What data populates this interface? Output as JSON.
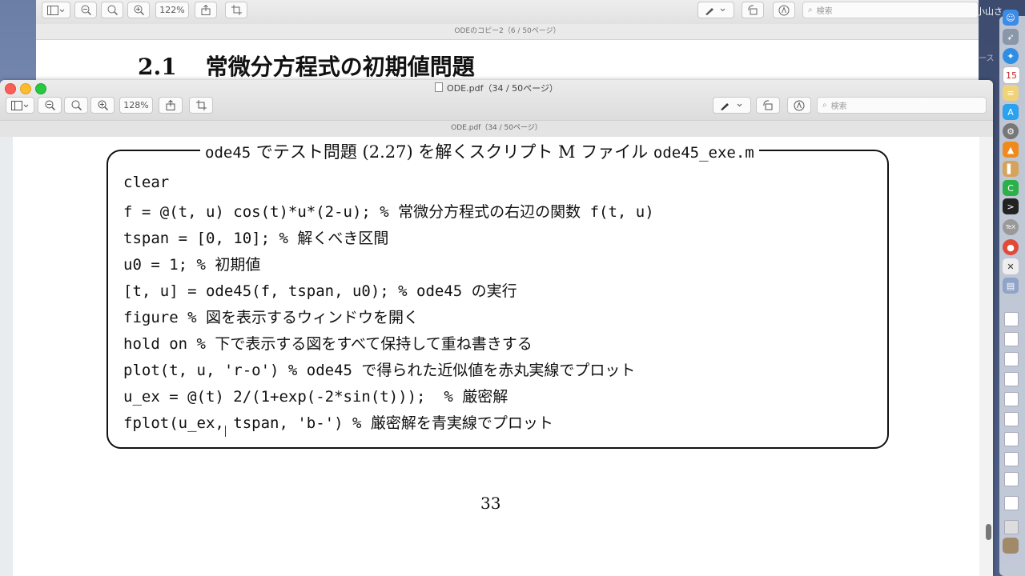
{
  "background_window": {
    "zoom": "122%",
    "search_placeholder": "検索",
    "subtitle": "ODEのコピー2（6 / 50ページ）",
    "heading_number": "2.1",
    "heading_text": "常微分方程式の初期値問題"
  },
  "desktop": {
    "corner_text": "小山さ",
    "side_fragment": "ース"
  },
  "window": {
    "title": "ODE.pdf（34 / 50ページ）",
    "zoom": "128%",
    "search_placeholder": "検索",
    "subtitle": "ODE.pdf（34 / 50ページ）"
  },
  "document": {
    "caption_prefix": "ode45",
    "caption_middle": " でテスト問題 (2.27) を解くスクリプト M ファイル ",
    "caption_file": "ode45_exe.m",
    "code_lines": [
      "clear",
      "f = @(t, u) cos(t)*u*(2-u); % 常微分方程式の右辺の関数 f(t, u)",
      "tspan = [0, 10]; % 解くべき区間",
      "u0 = 1; % 初期値",
      "[t, u] = ode45(f, tspan, u0); % ode45 の実行",
      "figure % 図を表示するウィンドウを開く",
      "hold on % 下で表示する図をすべて保持して重ね書きする",
      "plot(t, u, 'r-o') % ode45 で得られた近似値を赤丸実線でプロット",
      "u_ex = @(t) 2/(1+exp(-2*sin(t)));  % 厳密解",
      "fplot(u_ex, tspan, 'b-') % 厳密解を青実線でプロット"
    ],
    "page_number": "33"
  },
  "dock": {
    "icons": [
      "finder-icon",
      "rocket-icon",
      "safari-icon",
      "calendar-icon",
      "notes-icon",
      "app-store-icon",
      "settings-icon",
      "vlc-icon",
      "evernote-icon",
      "terminal-icon",
      "tex-icon",
      "chrome-icon",
      "xcode-icon",
      "preview-icon"
    ],
    "calendar_day": "15"
  }
}
